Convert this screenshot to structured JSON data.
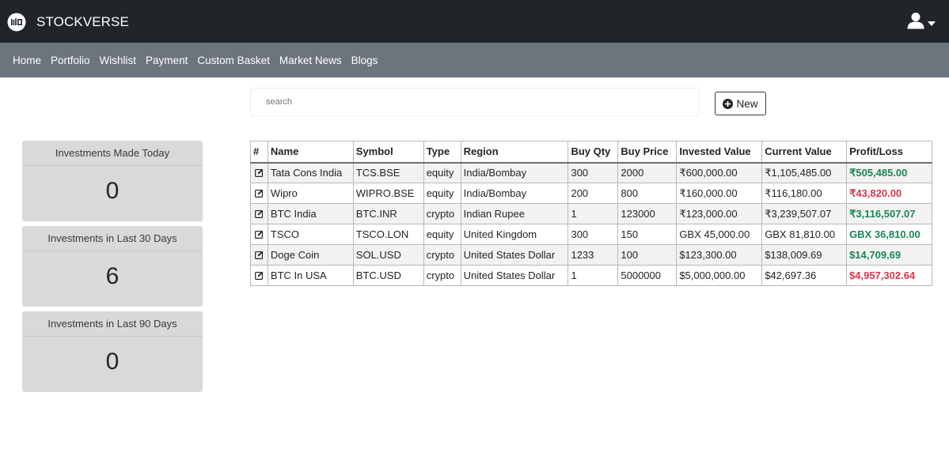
{
  "app": {
    "brand_name": "STOCKVERSE"
  },
  "nav": {
    "items": [
      "Home",
      "Portfolio",
      "Wishlist",
      "Payment",
      "Custom Basket",
      "Market News",
      "Blogs"
    ]
  },
  "search": {
    "placeholder": "search",
    "value": ""
  },
  "new_button": {
    "label": "New",
    "icon": "plus-circle-icon"
  },
  "stats": [
    {
      "title": "Investments Made Today",
      "value": "0"
    },
    {
      "title": "Investments in Last 30 Days",
      "value": "6"
    },
    {
      "title": "Investments in Last 90 Days",
      "value": "0"
    }
  ],
  "table": {
    "headers": [
      "#",
      "Name",
      "Symbol",
      "Type",
      "Region",
      "Buy Qty",
      "Buy Price",
      "Invested Value",
      "Current Value",
      "Profit/Loss"
    ],
    "rows": [
      {
        "name": "Tata Cons India",
        "symbol": "TCS.BSE",
        "type": "equity",
        "region": "India/Bombay",
        "buy_qty": "300",
        "buy_price": "2000",
        "invested_value": "₹600,000.00",
        "current_value": "₹1,105,485.00",
        "profit_loss": "₹505,485.00",
        "pl_status": "profit"
      },
      {
        "name": "Wipro",
        "symbol": "WIPRO.BSE",
        "type": "equity",
        "region": "India/Bombay",
        "buy_qty": "200",
        "buy_price": "800",
        "invested_value": "₹160,000.00",
        "current_value": "₹116,180.00",
        "profit_loss": "₹43,820.00",
        "pl_status": "loss"
      },
      {
        "name": "BTC India",
        "symbol": "BTC.INR",
        "type": "crypto",
        "region": "Indian Rupee",
        "buy_qty": "1",
        "buy_price": "123000",
        "invested_value": "₹123,000.00",
        "current_value": "₹3,239,507.07",
        "profit_loss": "₹3,116,507.07",
        "pl_status": "profit"
      },
      {
        "name": "TSCO",
        "symbol": "TSCO.LON",
        "type": "equity",
        "region": "United Kingdom",
        "buy_qty": "300",
        "buy_price": "150",
        "invested_value": "GBX 45,000.00",
        "current_value": "GBX 81,810.00",
        "profit_loss": "GBX 36,810.00",
        "pl_status": "profit"
      },
      {
        "name": "Doge Coin",
        "symbol": "SOL.USD",
        "type": "crypto",
        "region": "United States Dollar",
        "buy_qty": "1233",
        "buy_price": "100",
        "invested_value": "$123,300.00",
        "current_value": "$138,009.69",
        "profit_loss": "$14,709.69",
        "pl_status": "profit"
      },
      {
        "name": "BTC In USA",
        "symbol": "BTC.USD",
        "type": "crypto",
        "region": "United States Dollar",
        "buy_qty": "1",
        "buy_price": "5000000",
        "invested_value": "$5,000,000.00",
        "current_value": "$42,697.36",
        "profit_loss": "$4,957,302.64",
        "pl_status": "loss"
      }
    ]
  },
  "colors": {
    "topbar": "#212529",
    "navbar": "#6c757d",
    "card": "#d9d9d9",
    "profit": "#198754",
    "loss": "#dc3545"
  },
  "icons": {
    "logo": "stockverse-logo",
    "user": "user-icon",
    "caret": "caret-down-icon",
    "edit": "edit-icon"
  }
}
